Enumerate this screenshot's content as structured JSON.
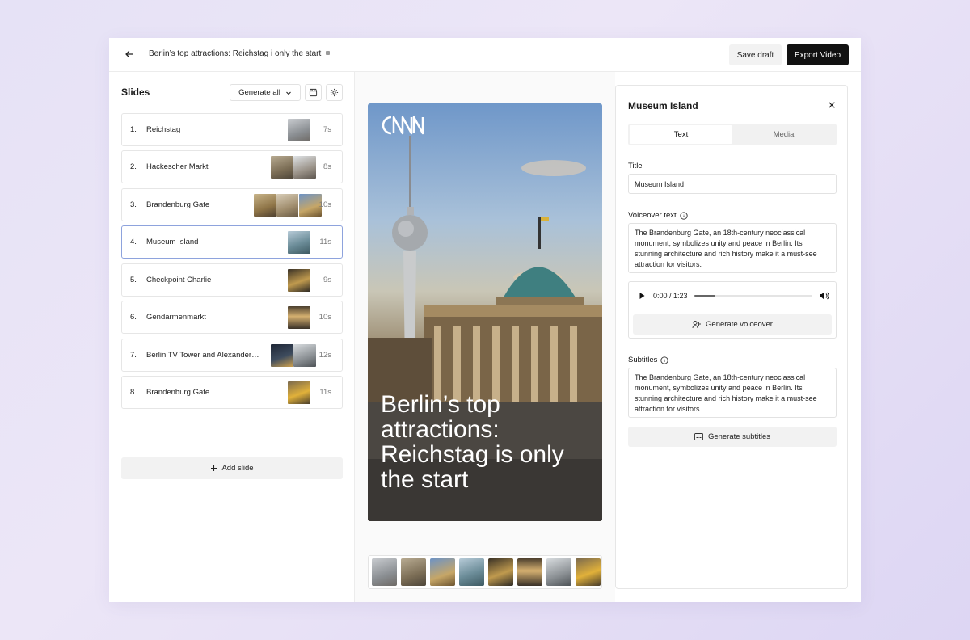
{
  "header": {
    "title": "Berlin’s top attractions: Reichstag i only the start",
    "save_label": "Save draft",
    "export_label": "Export Video"
  },
  "sidebar": {
    "heading": "Slides",
    "generate_all_label": "Generate all",
    "add_slide_label": "Add slide",
    "slides": [
      {
        "num": "1.",
        "name": "Reichstag",
        "duration": "7s"
      },
      {
        "num": "2.",
        "name": "Hackescher Markt",
        "duration": "8s"
      },
      {
        "num": "3.",
        "name": "Brandenburg Gate",
        "duration": "10s"
      },
      {
        "num": "4.",
        "name": "Museum Island",
        "duration": "11s"
      },
      {
        "num": "5.",
        "name": "Checkpoint Charlie",
        "duration": "9s"
      },
      {
        "num": "6.",
        "name": "Gendarmenmarkt",
        "duration": "10s"
      },
      {
        "num": "7.",
        "name": "Berlin TV Tower and Alexander…",
        "duration": "12s"
      },
      {
        "num": "8.",
        "name": "Brandenburg Gate",
        "duration": "11s"
      }
    ]
  },
  "preview": {
    "logo": "CNN",
    "headline": "Berlin’s top attractions: Reichstag is only the start"
  },
  "details": {
    "title": "Museum Island",
    "tabs": {
      "text": "Text",
      "media": "Media"
    },
    "title_label": "Title",
    "title_value": "Museum Island",
    "voiceover_label": "Voiceover text",
    "voiceover_value": "The Brandenburg Gate, an 18th-century neoclassical monument, symbolizes unity and peace in Berlin. Its stunning architecture and rich history make it a must-see attraction for visitors.",
    "audio_time": "0:00 / 1:23",
    "audio_progress": 0.18,
    "generate_voiceover_label": "Generate voiceover",
    "subtitles_label": "Subtitles",
    "subtitles_value": "The Brandenburg Gate, an 18th-century neoclassical monument, symbolizes unity and peace in Berlin. Its stunning architecture and rich history make it a must-see attraction for visitors.",
    "generate_subtitles_label": "Generate subtitles"
  },
  "colors": {
    "accent_border": "#8ea3dd",
    "primary_button": "#111111"
  }
}
